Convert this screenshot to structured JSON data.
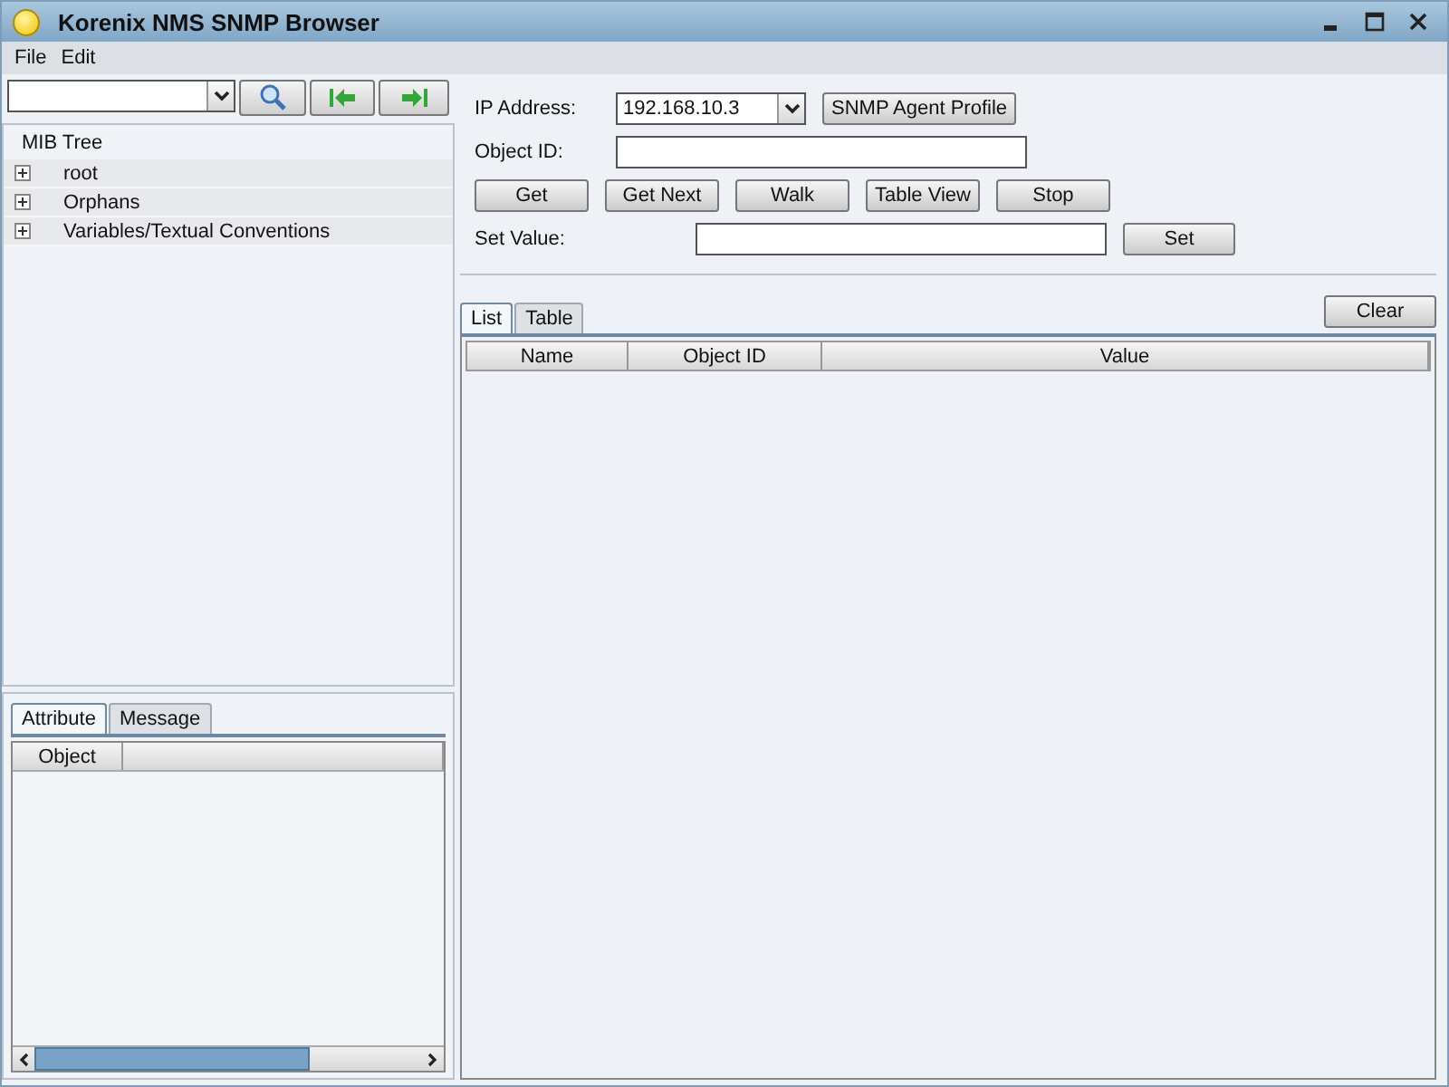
{
  "window": {
    "title": "Korenix NMS SNMP Browser"
  },
  "menu": [
    "File",
    "Edit"
  ],
  "mib_tree": {
    "title": "MIB Tree",
    "items": [
      {
        "label": "root",
        "expanded": false
      },
      {
        "label": "Orphans",
        "expanded": false
      },
      {
        "label": "Variables/Textual Conventions",
        "expanded": false
      }
    ]
  },
  "detail_tabs": [
    {
      "label": "Attribute",
      "selected": true
    },
    {
      "label": "Message",
      "selected": false
    }
  ],
  "detail_table": {
    "columns": [
      "Object"
    ]
  },
  "form": {
    "ip_label": "IP Address:",
    "ip_value": "192.168.10.3",
    "profile_button": "SNMP Agent Profile",
    "oid_label": "Object ID:",
    "actions": [
      "Get",
      "Get Next",
      "Walk",
      "Table View",
      "Stop"
    ],
    "set_label": "Set Value:",
    "set_button": "Set"
  },
  "result_tabs": [
    {
      "label": "List",
      "selected": true
    },
    {
      "label": "Table",
      "selected": false
    }
  ],
  "clear_button": "Clear",
  "result_table": {
    "columns": [
      "Name",
      "Object ID",
      "Value"
    ]
  }
}
